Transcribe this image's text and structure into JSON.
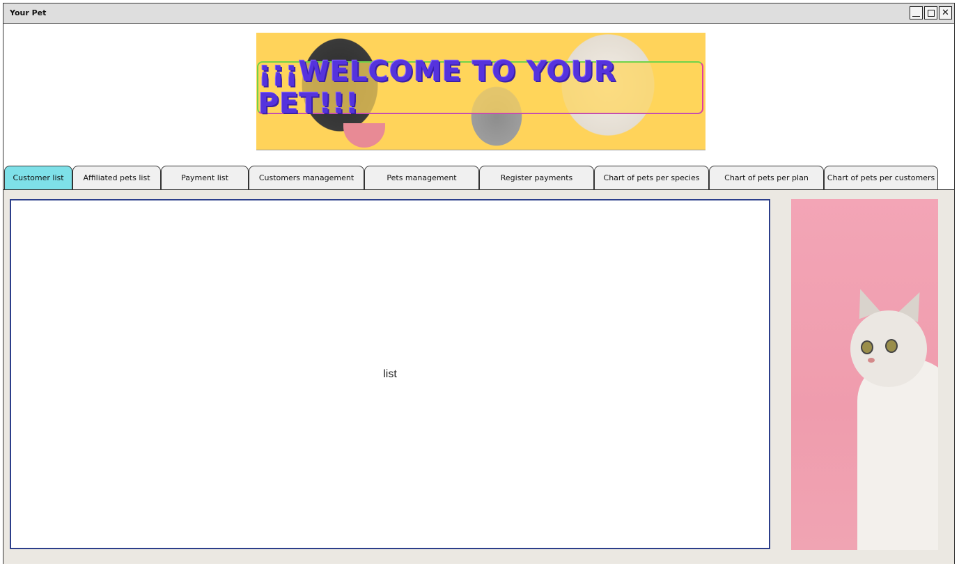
{
  "window": {
    "title": "Your Pet"
  },
  "banner": {
    "text": "¡¡¡Welcome to your pet!!!"
  },
  "tabs": [
    {
      "label": "Customer list",
      "active": true
    },
    {
      "label": "Affiliated pets list",
      "active": false
    },
    {
      "label": "Payment list",
      "active": false
    },
    {
      "label": "Customers management",
      "active": false
    },
    {
      "label": "Pets management",
      "active": false
    },
    {
      "label": "Register payments",
      "active": false
    },
    {
      "label": "Chart of pets per species",
      "active": false
    },
    {
      "label": "Chart of pets per plan",
      "active": false
    },
    {
      "label": "Chart of pets per customers",
      "active": false
    }
  ],
  "main": {
    "list_placeholder": "list"
  },
  "colors": {
    "active_tab": "#7ee0e8",
    "panel_border": "#2c3e8a",
    "banner_bg": "#ffd35a",
    "banner_text": "#5533dd",
    "content_bg": "#ebe8e2"
  }
}
